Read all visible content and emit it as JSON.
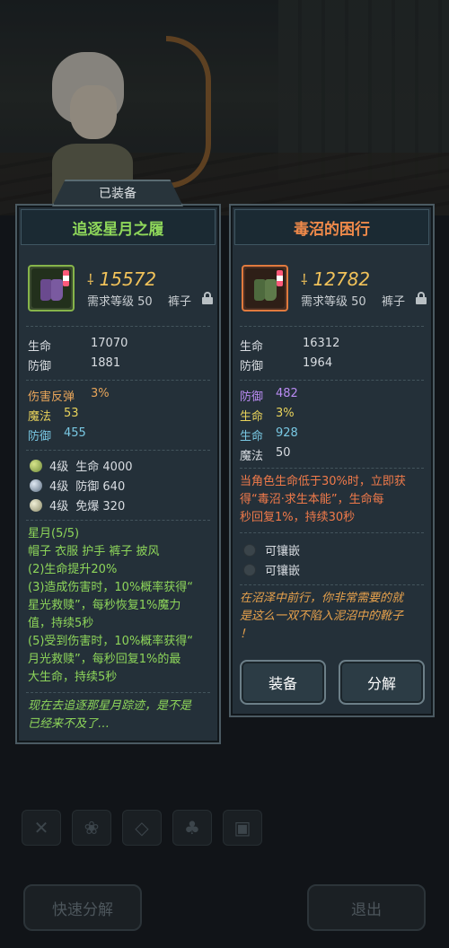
{
  "equipped_tab": "已装备",
  "left": {
    "name": "追逐星月之履",
    "power": "15572",
    "required_level": "需求等级 50",
    "slot": "裤子",
    "base_stats": [
      {
        "label": "生命",
        "value": "17070"
      },
      {
        "label": "防御",
        "value": "1881"
      }
    ],
    "extra_stats": [
      {
        "label": "伤害反弹",
        "value": "3%",
        "color": "#e8a55a"
      },
      {
        "label": "魔法",
        "value": "53",
        "color": "#e9d35b"
      },
      {
        "label": "防御",
        "value": "455",
        "color": "#79c8e3"
      }
    ],
    "gems": [
      {
        "level": "4级",
        "stat": "生命 4000",
        "color": "#9bb45a"
      },
      {
        "level": "4级",
        "stat": "防御 640",
        "color": "#8fa0b2"
      },
      {
        "level": "4级",
        "stat": "免爆 320",
        "color": "#b8b79a"
      }
    ],
    "set_title": "星月(5/5)",
    "set_pieces": "帽子 衣服 护手 裤子 披风",
    "set_bonus_2": "(2)生命提升20%",
    "set_bonus_3_l1": "(3)造成伤害时，10%概率获得“",
    "set_bonus_3_l2": "星光救赎”，每秒恢复1%魔力",
    "set_bonus_3_l3": "值，持续5秒",
    "set_bonus_5_l1": "(5)受到伤害时，10%概率获得“",
    "set_bonus_5_l2": "月光救赎”，每秒回复1%的最",
    "set_bonus_5_l3": "大生命，持续5秒",
    "flavor_l1": "现在去追逐那星月踪迹，是不是",
    "flavor_l2": "已经来不及了…"
  },
  "right": {
    "name": "毒沼的困行",
    "power": "12782",
    "required_level": "需求等级 50",
    "slot": "裤子",
    "base_stats": [
      {
        "label": "生命",
        "value": "16312"
      },
      {
        "label": "防御",
        "value": "1964"
      }
    ],
    "extra_stats": [
      {
        "label": "防御",
        "value": "482",
        "color": "#b98bf2"
      },
      {
        "label": "生命",
        "value": "3%",
        "color": "#e9d35b"
      },
      {
        "label": "生命",
        "value": "928",
        "color": "#79c8e3"
      },
      {
        "label": "魔法",
        "value": "50",
        "color": "#d9dde2"
      }
    ],
    "special_l1": "当角色生命低于30%时，立即获",
    "special_l2": "得“毒沼·求生本能”，生命每",
    "special_l3": "秒回复1%，持续30秒",
    "socket_1": "可镶嵌",
    "socket_2": "可镶嵌",
    "flavor_l1": "在沼泽中前行，你非常需要的就",
    "flavor_l2": "是这么一双不陷入泥沼中的靴子",
    "flavor_l3": "！",
    "equip_btn": "装备",
    "dismantle_btn": "分解"
  },
  "bottom": {
    "quick_dismantle": "快速分解",
    "exit": "退出",
    "filter_icons": [
      "weapon-icon",
      "paw-icon",
      "gem-icon",
      "bag-icon",
      "chest-icon"
    ]
  }
}
